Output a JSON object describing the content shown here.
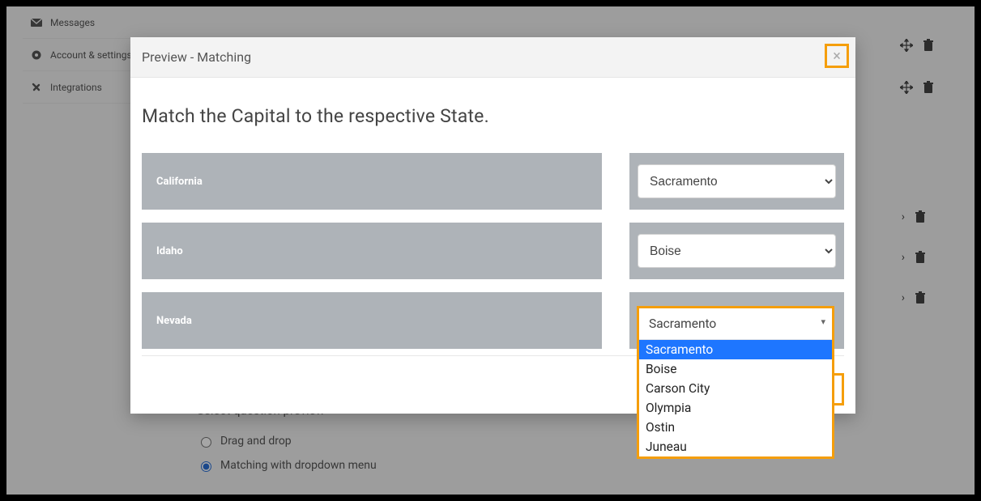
{
  "sidebar": {
    "items": [
      {
        "label": "Messages"
      },
      {
        "label": "Account & settings"
      },
      {
        "label": "Integrations"
      }
    ]
  },
  "modal": {
    "title": "Preview - Matching",
    "question": "Match the Capital to the respective State.",
    "rows": [
      {
        "label": "California",
        "selected": "Sacramento"
      },
      {
        "label": "Idaho",
        "selected": "Boise"
      },
      {
        "label": "Nevada",
        "selected": "Sacramento"
      }
    ],
    "options": [
      "Sacramento",
      "Boise",
      "Carson City",
      "Olympia",
      "Ostin",
      "Juneau"
    ]
  },
  "preview_section": {
    "heading": "Select question preview",
    "radios": [
      {
        "label": "Drag and drop",
        "checked": false
      },
      {
        "label": "Matching with dropdown menu",
        "checked": true
      }
    ]
  }
}
